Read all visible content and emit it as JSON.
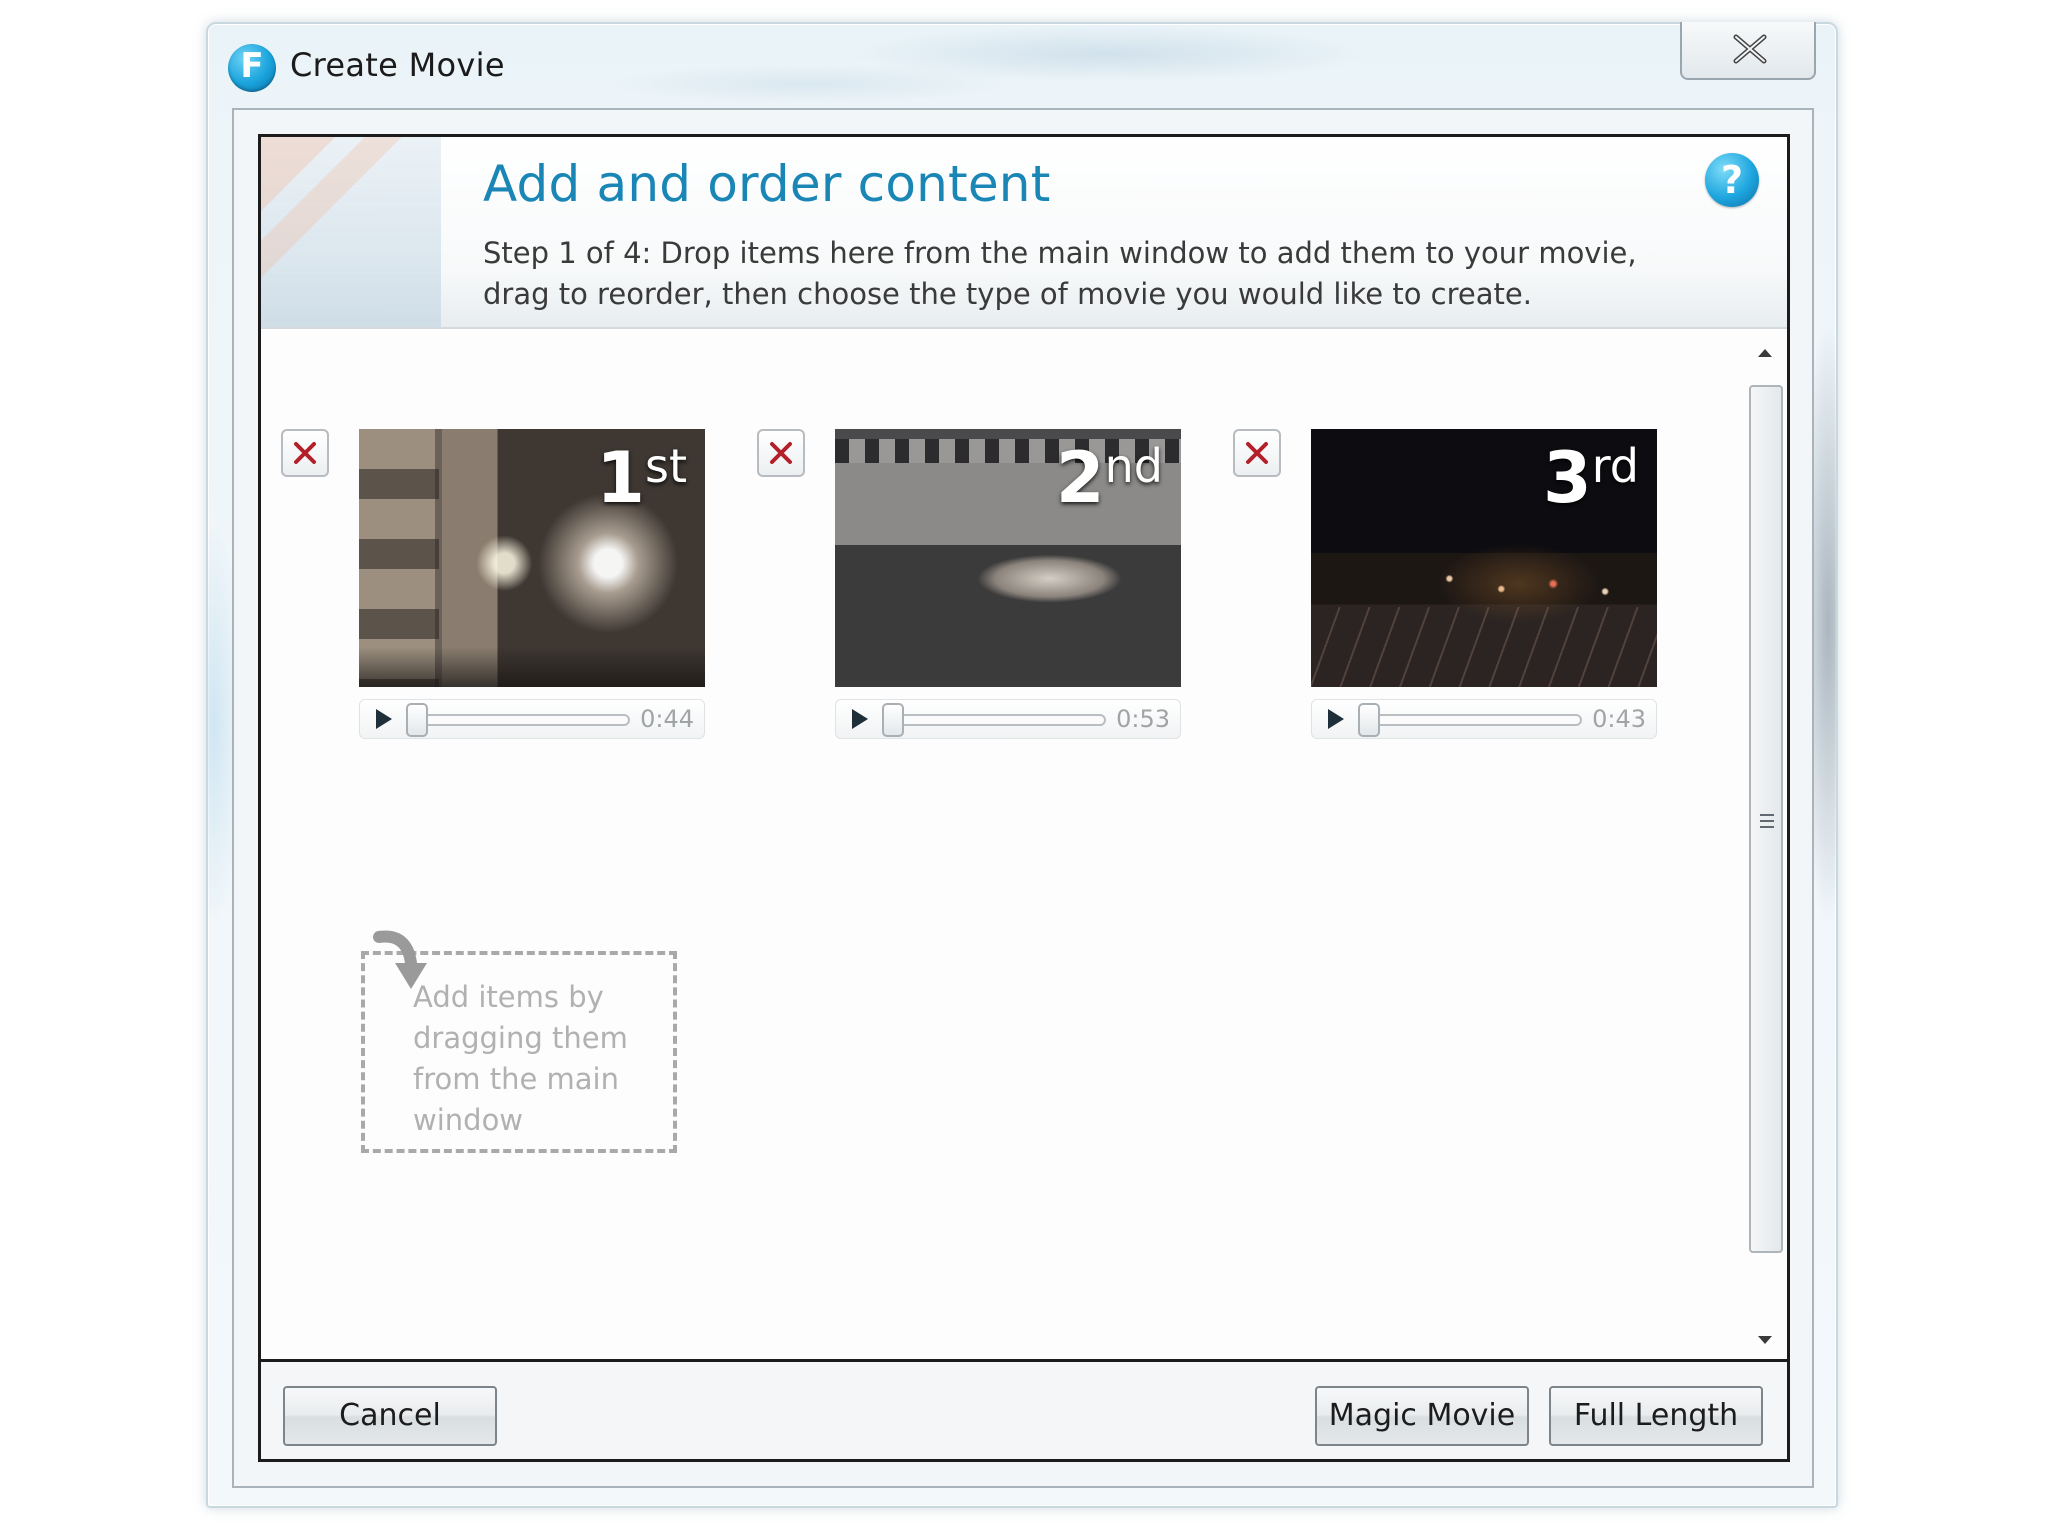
{
  "window": {
    "title": "Create Movie",
    "app_icon_letter": "F"
  },
  "header": {
    "title": "Add and order content",
    "description": "Step 1 of 4: Drop items here from the main window to add them to your movie, drag to reorder, then choose the type of movie you would like to create.",
    "help_glyph": "?"
  },
  "clips": [
    {
      "order_number": "1",
      "order_suffix": "st",
      "duration": "0:44"
    },
    {
      "order_number": "2",
      "order_suffix": "nd",
      "duration": "0:53"
    },
    {
      "order_number": "3",
      "order_suffix": "rd",
      "duration": "0:43"
    }
  ],
  "drop_zone": {
    "text": "Add items by dragging them from the main window"
  },
  "footer": {
    "cancel_label": "Cancel",
    "magic_movie_label": "Magic Movie",
    "full_length_label": "Full Length"
  },
  "colors": {
    "accent": "#1a86b6",
    "help_icon": "#1ea6df",
    "placeholder_text": "#b1b1b1",
    "remove_icon": "#b3202a"
  },
  "icons": {
    "app": "flip-video-logo-icon",
    "close": "close-icon",
    "help": "help-icon",
    "remove": "remove-x-icon",
    "play": "play-icon",
    "drop_arrow": "curved-arrow-down-icon",
    "scroll_up": "scroll-up-arrow-icon",
    "scroll_down": "scroll-down-arrow-icon"
  }
}
